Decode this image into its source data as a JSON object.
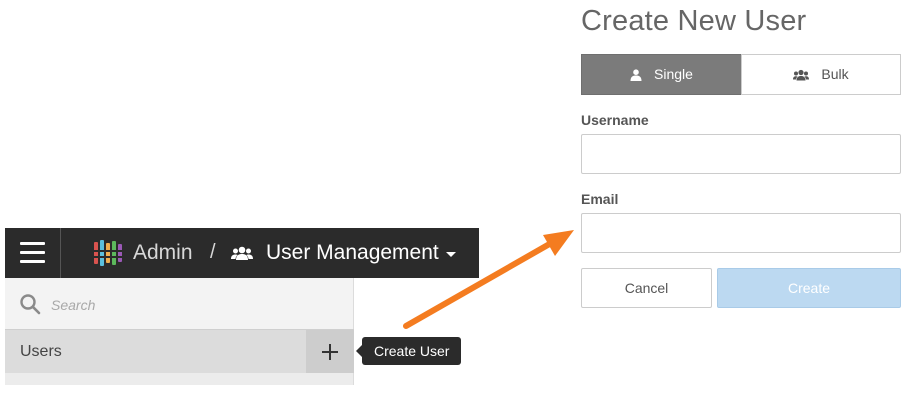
{
  "topbar": {
    "app_label": "Admin",
    "separator": "/",
    "section_label": "User Management"
  },
  "sidebar": {
    "search_placeholder": "Search",
    "users_label": "Users"
  },
  "tooltip": {
    "text": "Create User"
  },
  "form": {
    "title": "Create New User",
    "tabs": [
      {
        "label": "Single",
        "active": true,
        "icon": "user-icon"
      },
      {
        "label": "Bulk",
        "active": false,
        "icon": "users-icon"
      }
    ],
    "username_label": "Username",
    "username_value": "",
    "email_label": "Email",
    "email_value": "",
    "cancel_label": "Cancel",
    "create_label": "Create"
  },
  "colors": {
    "topbar": "#2b2b2b",
    "annotation_arrow": "#f47c20",
    "active_tab": "#7b7b7b",
    "create_button": "#bcd9f1"
  }
}
